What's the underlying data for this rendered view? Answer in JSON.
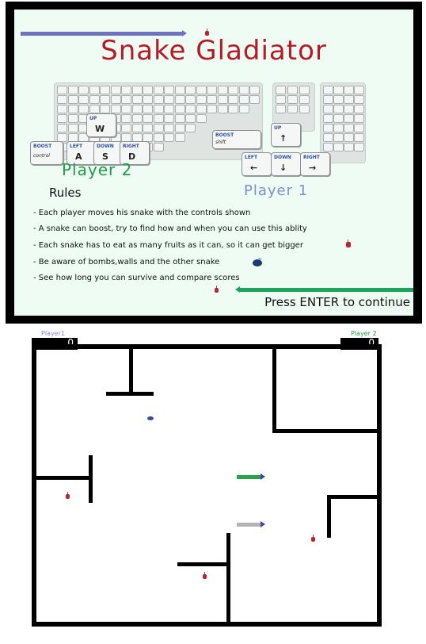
{
  "title_screen": {
    "title": "Snake Gladiator",
    "keyboard": {
      "wasd": {
        "up_label": "UP",
        "up_key": "W",
        "left_label": "LEFT",
        "left_key": "A",
        "down_label": "DOWN",
        "down_key": "S",
        "right_label": "RIGHT",
        "right_key": "D",
        "boost_label": "BOOST",
        "boost_key": "control"
      },
      "arrows": {
        "up_label": "UP",
        "up_key": "↑",
        "left_label": "LEFT",
        "left_key": "←",
        "down_label": "DOWN",
        "down_key": "↓",
        "right_label": "RIGHT",
        "right_key": "→",
        "boost_label": "BOOST",
        "boost_key": "shift"
      }
    },
    "player2_label": "Player 2",
    "player1_label": "Player 1",
    "rules_heading": "Rules",
    "rules": [
      "- Each player moves his snake with the controls shown",
      "- A snake can boost, try to find how and when you can use this ablity",
      "- Each snake has to eat as many fruits as it can, so it can get bigger",
      "- Be aware of bombs,walls and the other snake",
      "- See how long you can survive and compare scores"
    ],
    "continue_prompt": "Press ENTER to continue",
    "colors": {
      "title": "#b51b26",
      "player1": "#7b8ed0",
      "player2": "#1f9a48",
      "snake1": "#6d73c4",
      "snake2": "#1aa65a"
    }
  },
  "arena": {
    "player1_tag": "Player1",
    "player2_tag": "Player 2",
    "player1_score": "0",
    "player2_score": "0",
    "colors": {
      "snake_green": "#2aa24a",
      "snake_grey": "#b4b4b4",
      "walls": "#000000"
    }
  }
}
